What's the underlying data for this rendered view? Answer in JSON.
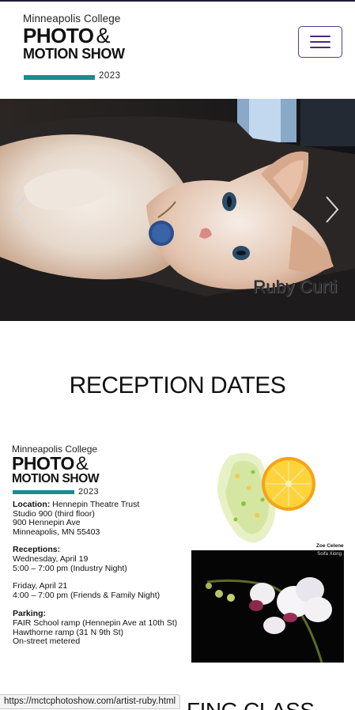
{
  "logo": {
    "line1": "Minneapolis College",
    "line2": "PHOTO",
    "amp": "&",
    "line3": "MOTION SHOW",
    "year": "2023",
    "bar_color": "#1a8c90"
  },
  "nav": {
    "menu_icon": "hamburger-menu-icon",
    "border_color": "#5a3a8c"
  },
  "carousel": {
    "caption": "Ruby Curti",
    "prev_icon": "chevron-left-icon",
    "next_icon": "chevron-right-icon"
  },
  "reception": {
    "title": "RECEPTION DATES"
  },
  "poster": {
    "logo": {
      "line1": "Minneapolis College",
      "line2": "PHOTO",
      "amp": "&",
      "line3": "MOTION SHOW",
      "year": "2023"
    },
    "location_label": "Location:",
    "location_name": "Hennepin Theatre Trust",
    "location_lines": [
      "Studio 900 (third floor)",
      "900 Hennepin Ave",
      "Minneapolis, MN 55403"
    ],
    "receptions_label": "Receptions:",
    "reception1_day": "Wednesday, April 19",
    "reception1_time": "5:00 – 7:00 pm (Industry Night)",
    "reception2_day": "Friday, April 21",
    "reception2_time": "4:00 – 7:00 pm (Friends & Family Night)",
    "parking_label": "Parking:",
    "parking_lines": [
      "FAIR School ramp (Hennepin Ave at 10th St)",
      "Hawthorne ramp (31 N 9th St)",
      "On-street metered"
    ],
    "fruit_credit": "Zoe Celene",
    "orchid_credit": "Soifa Xiong"
  },
  "next_section": {
    "partial_title": "FING CLASS"
  },
  "status_url": "https://mctcphotoshow.com/artist-ruby.html"
}
